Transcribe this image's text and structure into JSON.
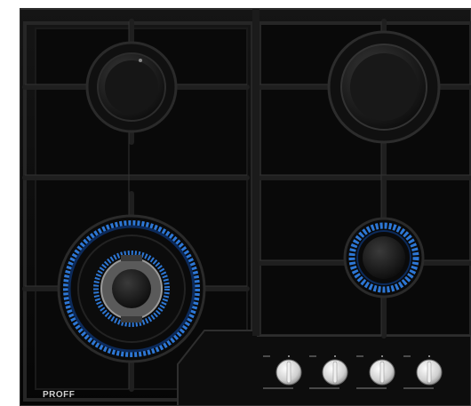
{
  "product": {
    "brand": "PROFF"
  },
  "burners": [
    {
      "id": "rear-left",
      "lit": false
    },
    {
      "id": "rear-right",
      "lit": false
    },
    {
      "id": "front-left",
      "lit": true,
      "type": "triple-crown"
    },
    {
      "id": "front-right",
      "lit": true
    }
  ],
  "knobs": [
    {
      "id": "knob-1"
    },
    {
      "id": "knob-2"
    },
    {
      "id": "knob-3"
    },
    {
      "id": "knob-4"
    }
  ],
  "colors": {
    "glass": "#0b0b0b",
    "grate": "#1c1c1c",
    "flame": "#2f7de0",
    "frame": "#3a3a3a",
    "knob": "#d8d8d8"
  }
}
